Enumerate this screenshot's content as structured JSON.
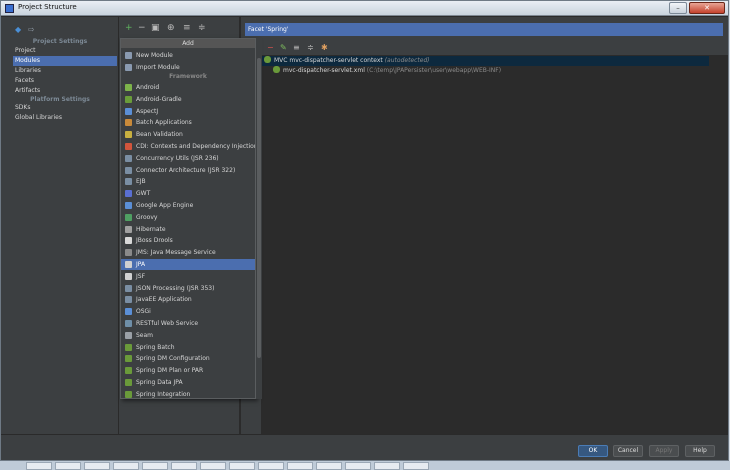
{
  "window": {
    "title": "Project Structure",
    "min_glyph": "–",
    "close_glyph": "✕"
  },
  "nav": {
    "back_glyph": "◆",
    "forward_glyph": "⇨",
    "project_settings_header": "Project Settings",
    "project_items": [
      "Project",
      "Modules",
      "Libraries",
      "Facets",
      "Artifacts"
    ],
    "selected": "Modules",
    "platform_settings_header": "Platform Settings",
    "platform_items": [
      "SDKs",
      "Global Libraries"
    ]
  },
  "middle_toolbar": {
    "add": "+",
    "remove": "−",
    "copy": "▣",
    "search": "⊕",
    "expand": "≡",
    "collapse": "≑"
  },
  "add_menu": {
    "header": "Add",
    "top_items": [
      "New Module",
      "Import Module"
    ],
    "framework_header": "Framework",
    "frameworks": [
      "Android",
      "Android-Gradle",
      "AspectJ",
      "Batch Applications",
      "Bean Validation",
      "CDI: Contexts and Dependency Injection",
      "Concurrency Utils (JSR 236)",
      "Connector Architecture (JSR 322)",
      "EJB",
      "GWT",
      "Google App Engine",
      "Groovy",
      "Hibernate",
      "JBoss Drools",
      "JMS: Java Message Service",
      "JPA",
      "JSF",
      "JSON Processing (JSR 353)",
      "JavaEE Application",
      "OSGi",
      "RESTful Web Service",
      "Seam",
      "Spring Batch",
      "Spring DM Configuration",
      "Spring DM Plan or PAR",
      "Spring Data JPA",
      "Spring Integration"
    ],
    "selected": "JPA"
  },
  "facet": {
    "header": "Facet 'Spring'",
    "tree": {
      "context_label": "MVC mvc-dispatcher-servlet context",
      "context_note": "(autodetected)",
      "file_label": "mvc-dispatcher-servlet.xml",
      "file_path": "(C:\\temp\\JPAPersister\\user\\webapp\\WEB-INF)"
    }
  },
  "buttons": {
    "ok": "OK",
    "cancel": "Cancel",
    "apply": "Apply",
    "help": "Help"
  },
  "colors": {
    "selection": "#4b6eaf",
    "panel": "#3c3f41",
    "background": "#2b2b2b"
  }
}
